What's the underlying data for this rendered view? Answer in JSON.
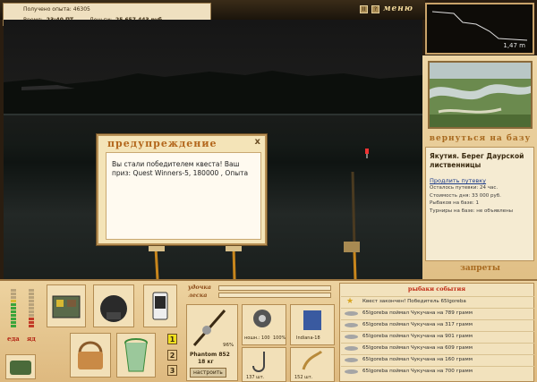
{
  "status": {
    "experience_label": "Получено опыта:",
    "experience_value": "46305",
    "time_label": "Время:",
    "time_value": "23:40 ПТ",
    "money_label": "Деньги:",
    "money_value": "25 657 443 руб."
  },
  "topbar": {
    "icon1": "II",
    "icon2": "?",
    "menu_label": "меню"
  },
  "minimap": {
    "depth": "1,47 m"
  },
  "right": {
    "return_label": "вернуться на базу",
    "location_title": "Якутия. Берег Даурской лиственницы",
    "extend_trip": "Продлить путевку",
    "trip_left": "Осталось путевки: 24 час.",
    "day_cost": "Стоимость дня: 33 000 руб.",
    "fishers_at_base": "Рыбаков на базе: 1",
    "tournaments": "Турниры на базе: не объявлены",
    "bans_label": "запреты"
  },
  "dialog": {
    "title": "предупреждение",
    "close": "x",
    "message": "Вы стали победителем квеста! Ваш приз: Quest Winners-5, 180000 , Опыта"
  },
  "bottom": {
    "food_label": "еда",
    "poison_label": "яд",
    "rod_label": "удочка",
    "line_label": "леска",
    "rod_name": "Phantom 852",
    "rod_weight": "18 кг",
    "rod_percent": "96%",
    "setup_button": "настроить",
    "reel_label": "ношн.: 100",
    "reel_percent": "100%",
    "bait_label": "Indiana-18",
    "hook_count": "137 шт.",
    "lure_count": "152 шт.",
    "levels": [
      "1",
      "2",
      "3"
    ]
  },
  "events": {
    "header": "рыбаки события",
    "rows": [
      {
        "icon": "star-icon",
        "text": "Квест закончен! Победитель 65Igoreba"
      },
      {
        "icon": "fish-icon",
        "text": "65Igoreba поймал Чукучана на 789 грамм"
      },
      {
        "icon": "fish-icon",
        "text": "65Igoreba поймал Чукучана на 317 грамм"
      },
      {
        "icon": "fish-icon",
        "text": "65Igoreba поймал Чукучана на 901 грамм"
      },
      {
        "icon": "fish-icon",
        "text": "65Igoreba поймал Чукучана на 609 грамм"
      },
      {
        "icon": "fish-icon",
        "text": "65Igoreba поймал Чукучана на 160 грамм"
      },
      {
        "icon": "fish-icon",
        "text": "65Igoreba поймал Чукучана на 700 грамм"
      }
    ]
  },
  "colors": {
    "accent": "#b3671c",
    "event_header": "#c02a14",
    "link": "#1a3a8a"
  }
}
